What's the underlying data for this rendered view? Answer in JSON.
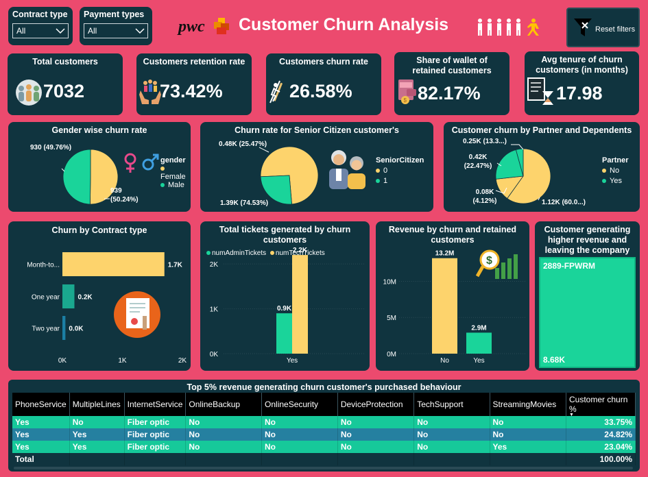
{
  "filters": {
    "contract": {
      "label": "Contract type",
      "value": "All"
    },
    "payment": {
      "label": "Payment types",
      "value": "All"
    }
  },
  "header": {
    "logo": "pwc",
    "title": "Customer Churn Analysis",
    "reset_label": "Reset filters"
  },
  "kpis": {
    "total": {
      "title": "Total customers",
      "value": "7032"
    },
    "retention": {
      "title": "Customers retention rate",
      "value": "73.42%"
    },
    "churn": {
      "title": "Customers churn rate",
      "value": "26.58%"
    },
    "wallet": {
      "title": "Share of wallet of retained customers",
      "value": "82.17%"
    },
    "tenure": {
      "title": "Avg tenure of churn customers (in months)",
      "value": "17.98"
    }
  },
  "chart_data": [
    {
      "type": "pie",
      "title": "Gender wise churn rate",
      "legend_title": "gender",
      "labels": [
        "Female",
        "Male"
      ],
      "values": [
        939,
        930
      ],
      "data_labels": [
        "939 (50.24%)",
        "930 (49.76%)"
      ],
      "colors": [
        "#fdd36c",
        "#1ad49a"
      ]
    },
    {
      "type": "pie",
      "title": "Churn rate for Senior Citizen customer's",
      "legend_title": "SeniorCitizen",
      "labels": [
        "0",
        "1"
      ],
      "values": [
        1390,
        480
      ],
      "data_labels": [
        "1.39K (74.53%)",
        "0.48K (25.47%)"
      ],
      "colors": [
        "#fdd36c",
        "#1ad49a"
      ]
    },
    {
      "type": "pie",
      "title": "Customer churn by Partner and Dependents",
      "legend_title": "Partner",
      "labels": [
        "No",
        "Yes"
      ],
      "slices": [
        {
          "partner": "No",
          "value": 1120,
          "label": "1.12K (60.0...)",
          "color": "#fdd36c"
        },
        {
          "partner": "No",
          "value": 250,
          "label": "0.25K (13.3...)",
          "color": "#fdd36c"
        },
        {
          "partner": "Yes",
          "value": 420,
          "label": "0.42K (22.47%)",
          "color": "#1ad49a"
        },
        {
          "partner": "Yes",
          "value": 80,
          "label": "0.08K (4.12%)",
          "color": "#1ad49a"
        }
      ],
      "colors": [
        "#fdd36c",
        "#1ad49a"
      ]
    },
    {
      "type": "bar",
      "title": "Churn by Contract type",
      "orientation": "horizontal",
      "categories": [
        "Month-to...",
        "One year",
        "Two year"
      ],
      "values": [
        1700,
        200,
        50
      ],
      "data_labels": [
        "1.7K",
        "0.2K",
        "0.0K"
      ],
      "colors": [
        "#fdd36c",
        "#1aa88f",
        "#1b7fa5"
      ],
      "xticks": [
        "0K",
        "1K",
        "2K"
      ],
      "xlim": [
        0,
        2000
      ]
    },
    {
      "type": "bar",
      "title": "Total tickets generated by churn customers",
      "categories": [
        "Yes"
      ],
      "series": [
        {
          "name": "numAdminTickets",
          "values": [
            900
          ],
          "label": "0.9K",
          "color": "#1ad49a"
        },
        {
          "name": "numTechTickets",
          "values": [
            2200
          ],
          "label": "2.2K",
          "color": "#fdd36c"
        }
      ],
      "yticks": [
        "0K",
        "1K",
        "2K"
      ],
      "ylim": [
        0,
        2400
      ]
    },
    {
      "type": "bar",
      "title": "Revenue by churn and retained customers",
      "categories": [
        "No",
        "Yes"
      ],
      "values": [
        13200000,
        2900000
      ],
      "data_labels": [
        "13.2M",
        "2.9M"
      ],
      "colors": [
        "#fdd36c",
        "#1ad49a"
      ],
      "yticks": [
        "0M",
        "5M",
        "10M"
      ],
      "ylim": [
        0,
        14500000
      ]
    }
  ],
  "treemap": {
    "title": "Customer generating higher revenue and leaving the company",
    "id": "2889-FPWRM",
    "value": "8.68K"
  },
  "table": {
    "title": "Top 5% revenue generating churn customer's purchased behaviour",
    "columns": [
      "PhoneService",
      "MultipleLines",
      "InternetService",
      "OnlineBackup",
      "OnlineSecurity",
      "DeviceProtection",
      "TechSupport",
      "StreamingMovies",
      "Customer churn %"
    ],
    "rows": [
      [
        "Yes",
        "No",
        "Fiber optic",
        "No",
        "No",
        "No",
        "No",
        "No",
        "33.75%"
      ],
      [
        "Yes",
        "Yes",
        "Fiber optic",
        "No",
        "No",
        "No",
        "No",
        "No",
        "24.82%"
      ],
      [
        "Yes",
        "Yes",
        "Fiber optic",
        "No",
        "No",
        "No",
        "No",
        "Yes",
        "23.04%"
      ]
    ],
    "total": {
      "label": "Total",
      "value": "100.00%"
    }
  }
}
